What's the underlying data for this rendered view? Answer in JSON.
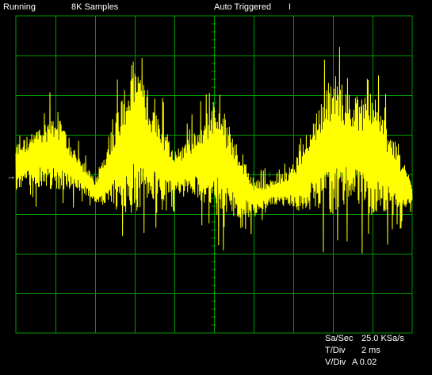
{
  "status": {
    "run_state": "Running",
    "samples": "8K Samples",
    "trigger": "Auto Triggered",
    "trigger_marker": "I"
  },
  "readouts": {
    "sample_rate_label": "Sa/Sec",
    "sample_rate_value": "25.0 KSa/s",
    "time_div_label": "T/Div",
    "time_div_value": "2 ms",
    "volt_div_label": "V/Div",
    "volt_div_value": "A 0.02"
  },
  "display": {
    "trace_color": "#ffff00",
    "grid_color": "#009900",
    "background_color": "#000000",
    "h_divisions": 10,
    "v_divisions": 8,
    "trigger_level_marker": "→"
  },
  "chart_data": {
    "type": "line",
    "title": "",
    "xlabel": "",
    "ylabel": "",
    "xlim": [
      0,
      20
    ],
    "ylim": [
      -4,
      4
    ],
    "x_unit": "ms",
    "y_unit": "divisions",
    "grid": true,
    "series": [
      {
        "description_only": "noisy signal with ~6.7 ms envelope",
        "envelope": [
          [
            0,
            0.6
          ],
          [
            1,
            0.7
          ],
          [
            2,
            1.0
          ],
          [
            3,
            0.5
          ],
          [
            4,
            0.3
          ],
          [
            5,
            1.2
          ],
          [
            6,
            2.0
          ],
          [
            7,
            1.2
          ],
          [
            8,
            0.6
          ],
          [
            9,
            0.8
          ],
          [
            10,
            1.4
          ],
          [
            11,
            1.1
          ],
          [
            12,
            0.5
          ],
          [
            13,
            0.3
          ],
          [
            14,
            0.6
          ],
          [
            15,
            1.2
          ],
          [
            16,
            1.8
          ],
          [
            17,
            1.3
          ],
          [
            18,
            1.6
          ],
          [
            19,
            1.0
          ],
          [
            20,
            0.3
          ]
        ],
        "baseline": [
          [
            0,
            0.2
          ],
          [
            2,
            0.6
          ],
          [
            4,
            -0.4
          ],
          [
            6,
            1.0
          ],
          [
            8,
            0.0
          ],
          [
            10,
            0.5
          ],
          [
            12,
            -0.6
          ],
          [
            14,
            -0.3
          ],
          [
            16,
            0.8
          ],
          [
            18,
            0.5
          ],
          [
            20,
            -0.5
          ]
        ]
      }
    ]
  }
}
